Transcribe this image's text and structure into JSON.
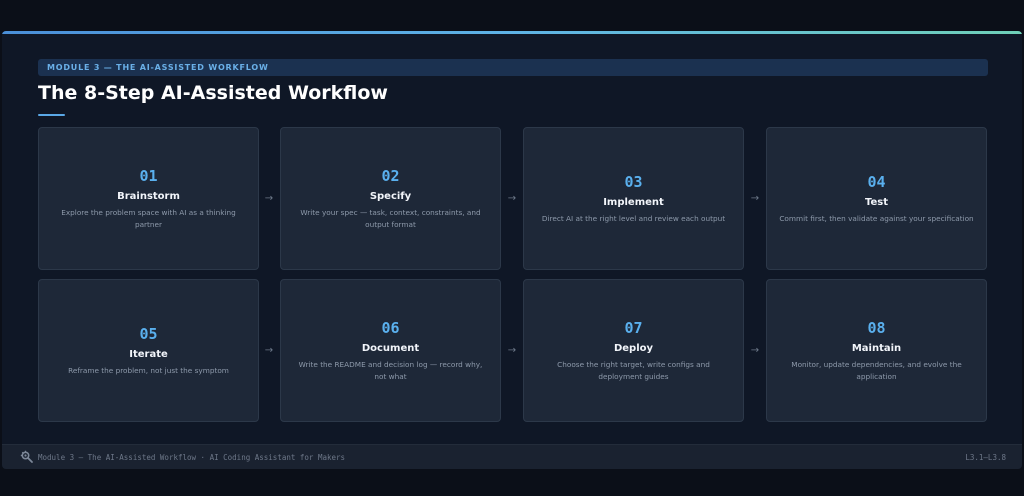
{
  "module_label": "MODULE 3 — THE AI-ASSISTED WORKFLOW",
  "page_title": "The 8-Step AI-Assisted Workflow",
  "steps": [
    {
      "number": "01",
      "title": "Brainstorm",
      "description": "Explore the problem space with AI as a thinking partner"
    },
    {
      "number": "02",
      "title": "Specify",
      "description": "Write your spec — task, context, constraints, and output format"
    },
    {
      "number": "03",
      "title": "Implement",
      "description": "Direct AI at the right level and review each output"
    },
    {
      "number": "04",
      "title": "Test",
      "description": "Commit first, then validate against your specification"
    },
    {
      "number": "05",
      "title": "Iterate",
      "description": "Reframe the problem, not just the symptom"
    },
    {
      "number": "06",
      "title": "Document",
      "description": "Write the README and decision log — record why, not what"
    },
    {
      "number": "07",
      "title": "Deploy",
      "description": "Choose the right target, write configs and deployment guides"
    },
    {
      "number": "08",
      "title": "Maintain",
      "description": "Monitor, update dependencies, and evolve the application"
    }
  ],
  "arrow_glyph": "→",
  "footer": {
    "text": "Module 3 — The AI-Assisted Workflow · AI Coding Assistant for Makers",
    "ref": "L3.1–L3.8",
    "logo_icon": "magnifier-gear-icon"
  },
  "colors": {
    "accent": "#5ab0ee",
    "background": "#0f1726",
    "card": "#1e2838"
  }
}
